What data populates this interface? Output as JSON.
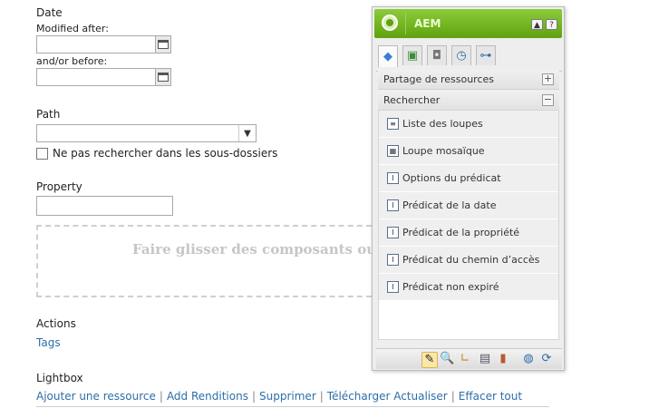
{
  "form": {
    "date_heading": "Date",
    "modified_after_label": "Modified after:",
    "before_label": "and/or before:",
    "path_heading": "Path",
    "no_subfolders_label": "Ne pas rechercher dans les sous-dossiers",
    "property_heading": "Property",
    "dropzone_text": "Faire glisser des composants ou ressources ici"
  },
  "actions": {
    "heading": "Actions",
    "tags_link": "Tags"
  },
  "lightbox": {
    "heading": "Lightbox",
    "links": [
      "Ajouter une ressource",
      "Add Renditions",
      "Supprimer",
      "Télécharger Actualiser",
      "Effacer tout"
    ]
  },
  "sidekick": {
    "title": "AEM",
    "header_buttons": {
      "collapse": "▲",
      "help": "?"
    },
    "tabs": [
      "components-tab-icon",
      "page-tab-icon",
      "lock-tab-icon",
      "versioning-tab-icon",
      "workflow-tab-icon"
    ],
    "sections": [
      {
        "label": "Partage de ressources",
        "toggle": "+"
      },
      {
        "label": "Rechercher",
        "toggle": "−"
      }
    ],
    "items": [
      {
        "label": "Liste des loupes",
        "icon": "list-icon",
        "glyph": "≡"
      },
      {
        "label": "Loupe mosaïque",
        "icon": "grid-icon",
        "glyph": "▦"
      },
      {
        "label": "Options du prédicat",
        "icon": "predicate-icon",
        "glyph": "I"
      },
      {
        "label": "Prédicat de la date",
        "icon": "predicate-icon",
        "glyph": "I"
      },
      {
        "label": "Prédicat de la propriété",
        "icon": "predicate-icon",
        "glyph": "I"
      },
      {
        "label": "Prédicat du chemin d’accès",
        "icon": "predicate-icon",
        "glyph": "I"
      },
      {
        "label": "Prédicat non expiré",
        "icon": "predicate-icon",
        "glyph": "I"
      }
    ],
    "footer": [
      "edit-icon",
      "search-icon",
      "ruler-icon",
      "page-icon",
      "design-icon",
      "globe-icon",
      "refresh-icon"
    ]
  },
  "colors": {
    "header_green": "#5fa20e",
    "link_blue": "#2d6ea8"
  }
}
